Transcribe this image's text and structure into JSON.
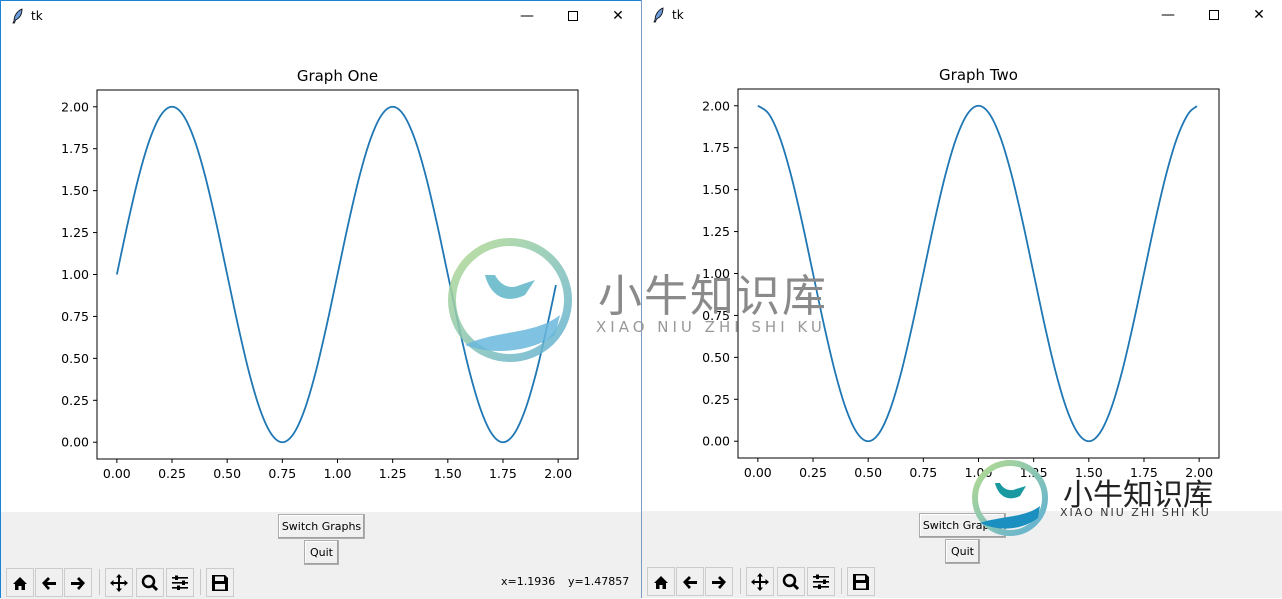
{
  "windows": [
    {
      "title": "tk",
      "chart_title": "Graph One",
      "buttons": {
        "switch": "Switch Graphs",
        "quit": "Quit"
      },
      "coords": {
        "x": "x=1.1936",
        "y": "y=1.47857"
      }
    },
    {
      "title": "tk",
      "chart_title": "Graph Two",
      "buttons": {
        "switch": "Switch Graphs",
        "quit": "Quit"
      }
    }
  ],
  "toolbar_icons": [
    "home-icon",
    "back-arrow-icon",
    "forward-arrow-icon",
    "pan-icon",
    "zoom-icon",
    "subplots-icon",
    "save-icon"
  ],
  "watermark": {
    "text": "小牛知识库",
    "subtext": "XIAO NIU ZHI SHI KU"
  },
  "chart_data": [
    {
      "type": "line",
      "title": "Graph One",
      "xlim": [
        -0.09,
        2.09
      ],
      "ylim": [
        -0.1,
        2.1
      ],
      "xticks": [
        "0.00",
        "0.25",
        "0.50",
        "0.75",
        "1.00",
        "1.25",
        "1.50",
        "1.75",
        "2.00"
      ],
      "yticks": [
        "0.00",
        "0.25",
        "0.50",
        "0.75",
        "1.00",
        "1.25",
        "1.50",
        "1.75",
        "2.00"
      ],
      "color": "#1f77b4",
      "x": [
        0,
        0.05,
        0.1,
        0.15,
        0.2,
        0.25,
        0.3,
        0.35,
        0.4,
        0.45,
        0.5,
        0.55,
        0.6,
        0.65,
        0.7,
        0.75,
        0.8,
        0.85,
        0.9,
        0.95,
        1,
        1.05,
        1.1,
        1.15,
        1.2,
        1.25,
        1.3,
        1.35,
        1.4,
        1.45,
        1.5,
        1.55,
        1.6,
        1.65,
        1.7,
        1.75,
        1.8,
        1.85,
        1.9,
        1.95,
        1.99
      ],
      "y": [
        1,
        1.309,
        1.588,
        1.809,
        1.951,
        2,
        1.951,
        1.809,
        1.588,
        1.309,
        1,
        0.691,
        0.412,
        0.191,
        0.049,
        0,
        0.049,
        0.191,
        0.412,
        0.691,
        1,
        1.309,
        1.588,
        1.809,
        1.951,
        2,
        1.951,
        1.809,
        1.588,
        1.309,
        1,
        0.691,
        0.412,
        0.191,
        0.049,
        0,
        0.049,
        0.191,
        0.412,
        0.691,
        0.937
      ]
    },
    {
      "type": "line",
      "title": "Graph Two",
      "xlim": [
        -0.09,
        2.09
      ],
      "ylim": [
        -0.1,
        2.1
      ],
      "xticks": [
        "0.00",
        "0.25",
        "0.50",
        "0.75",
        "1.00",
        "1.25",
        "1.50",
        "1.75",
        "2.00"
      ],
      "yticks": [
        "0.00",
        "0.25",
        "0.50",
        "0.75",
        "1.00",
        "1.25",
        "1.50",
        "1.75",
        "2.00"
      ],
      "color": "#1f77b4",
      "x": [
        0,
        0.05,
        0.1,
        0.15,
        0.2,
        0.25,
        0.3,
        0.35,
        0.4,
        0.45,
        0.5,
        0.55,
        0.6,
        0.65,
        0.7,
        0.75,
        0.8,
        0.85,
        0.9,
        0.95,
        1,
        1.05,
        1.1,
        1.15,
        1.2,
        1.25,
        1.3,
        1.35,
        1.4,
        1.45,
        1.5,
        1.55,
        1.6,
        1.65,
        1.7,
        1.75,
        1.8,
        1.85,
        1.9,
        1.95,
        1.99
      ],
      "y": [
        2,
        1.951,
        1.809,
        1.588,
        1.309,
        1,
        0.691,
        0.412,
        0.191,
        0.049,
        0,
        0.049,
        0.191,
        0.412,
        0.691,
        1,
        1.309,
        1.588,
        1.809,
        1.951,
        2,
        1.951,
        1.809,
        1.588,
        1.309,
        1,
        0.691,
        0.412,
        0.191,
        0.049,
        0,
        0.049,
        0.191,
        0.412,
        0.691,
        1,
        1.309,
        1.588,
        1.809,
        1.951,
        1.998
      ]
    }
  ]
}
